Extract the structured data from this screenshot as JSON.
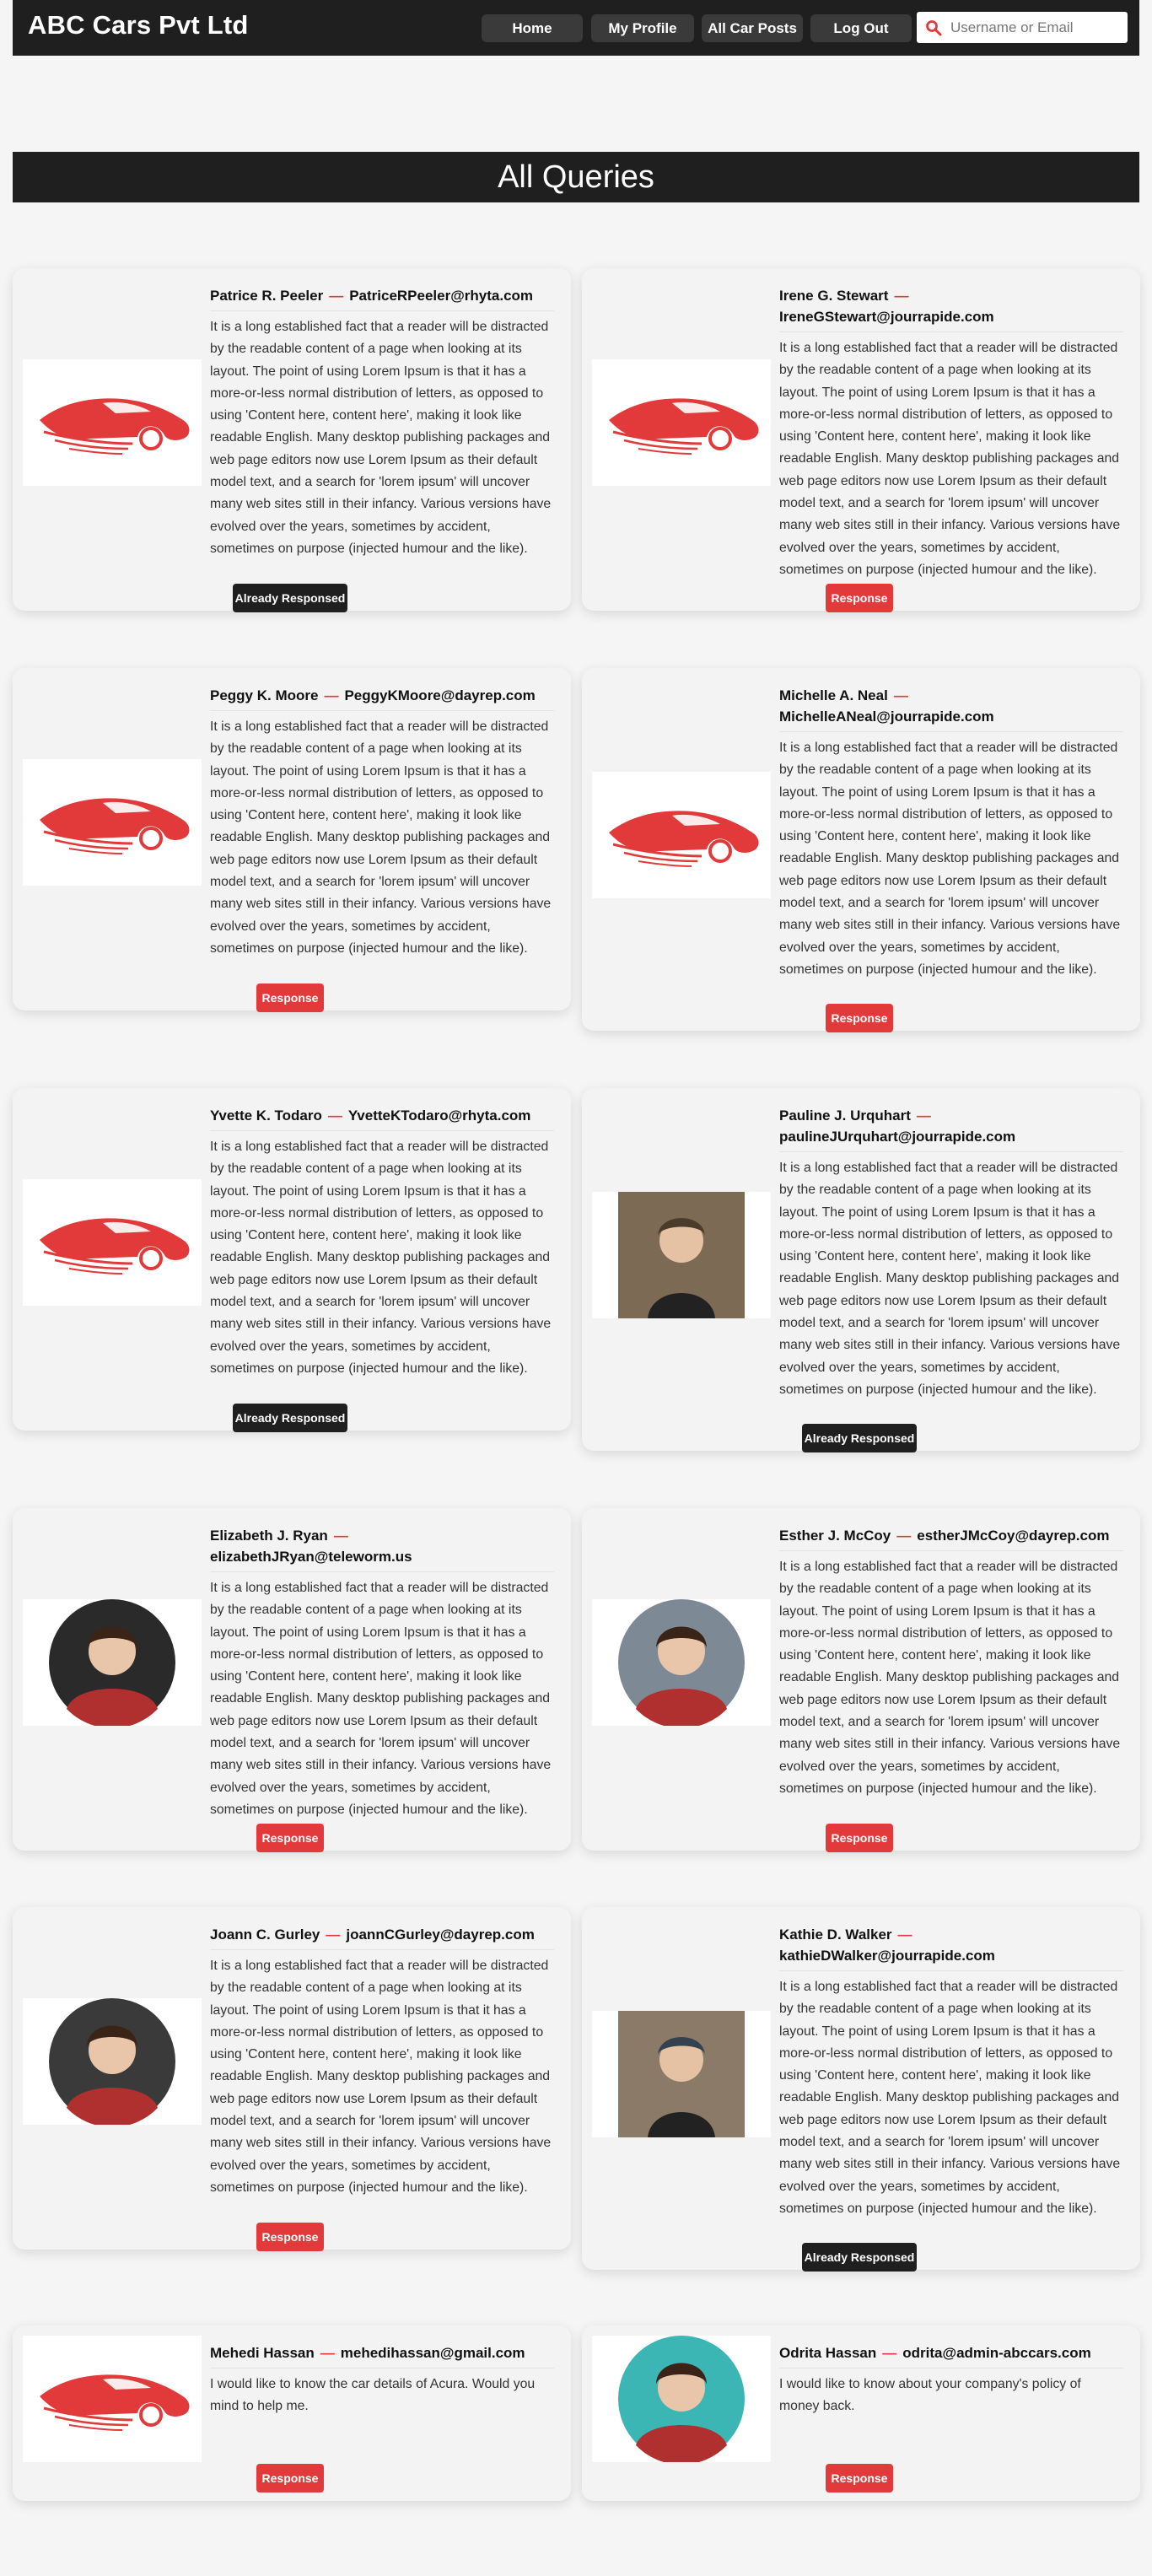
{
  "header": {
    "brand": "ABC Cars Pvt Ltd",
    "nav": [
      "Home",
      "My Profile",
      "All Car Posts",
      "Log Out"
    ],
    "search_placeholder": "Username or Email",
    "search_value": ""
  },
  "page_title": "All Queries",
  "lorem": "It is a long established fact that a reader will be distracted by the readable content of a page when looking at its layout. The point of using Lorem Ipsum is that it has a more-or-less normal distribution of letters, as opposed to using 'Content here, content here', making it look like readable English. Many desktop publishing packages and web page editors now use Lorem Ipsum as their default model text, and a search for 'lorem ipsum' will uncover many web sites still in their infancy. Various versions have evolved over the years, sometimes by accident, sometimes on purpose (injected humour and the like).",
  "queries": [
    {
      "name": "Patrice R. Peeler",
      "email": "PatriceRPeeler@rhyta.com",
      "message": "It is a long established fact that a reader will be distracted by the readable content of a page when looking at its layout. The point of using Lorem Ipsum is that it has a more-or-less normal distribution of letters, as opposed to using 'Content here, content here', making it look like readable English. Many desktop publishing packages and web page editors now use Lorem Ipsum as their default model text, and a search for 'lorem ipsum' will uncover many web sites still in their infancy. Various versions have evolved over the years, sometimes by accident, sometimes on purpose (injected humour and the like).",
      "image": "car-logo",
      "status": "Already Responsed"
    },
    {
      "name": "Irene G. Stewart",
      "email": "IreneGStewart@jourrapide.com",
      "message": "It is a long established fact that a reader will be distracted by the readable content of a page when looking at its layout. The point of using Lorem Ipsum is that it has a more-or-less normal distribution of letters, as opposed to using 'Content here, content here', making it look like readable English. Many desktop publishing packages and web page editors now use Lorem Ipsum as their default model text, and a search for 'lorem ipsum' will uncover many web sites still in their infancy. Various versions have evolved over the years, sometimes by accident, sometimes on purpose (injected humour and the like).",
      "image": "car-logo",
      "status": "Response"
    },
    {
      "name": "Peggy K. Moore",
      "email": "PeggyKMoore@dayrep.com",
      "message": "It is a long established fact that a reader will be distracted by the readable content of a page when looking at its layout. The point of using Lorem Ipsum is that it has a more-or-less normal distribution of letters, as opposed to using 'Content here, content here', making it look like readable English. Many desktop publishing packages and web page editors now use Lorem Ipsum as their default model text, and a search for 'lorem ipsum' will uncover many web sites still in their infancy. Various versions have evolved over the years, sometimes by accident, sometimes on purpose (injected humour and the like).",
      "image": "car-logo",
      "status": "Response"
    },
    {
      "name": "Michelle A. Neal",
      "email": "MichelleANeal@jourrapide.com",
      "message": "It is a long established fact that a reader will be distracted by the readable content of a page when looking at its layout. The point of using Lorem Ipsum is that it has a more-or-less normal distribution of letters, as opposed to using 'Content here, content here', making it look like readable English. Many desktop publishing packages and web page editors now use Lorem Ipsum as their default model text, and a search for 'lorem ipsum' will uncover many web sites still in their infancy. Various versions have evolved over the years, sometimes by accident, sometimes on purpose (injected humour and the like).",
      "image": "car-logo",
      "status": "Response"
    },
    {
      "name": "Yvette K. Todaro",
      "email": "YvetteKTodaro@rhyta.com",
      "message": "It is a long established fact that a reader will be distracted by the readable content of a page when looking at its layout. The point of using Lorem Ipsum is that it has a more-or-less normal distribution of letters, as opposed to using 'Content here, content here', making it look like readable English. Many desktop publishing packages and web page editors now use Lorem Ipsum as their default model text, and a search for 'lorem ipsum' will uncover many web sites still in their infancy. Various versions have evolved over the years, sometimes by accident, sometimes on purpose (injected humour and the like).",
      "image": "car-logo",
      "status": "Already Responsed"
    },
    {
      "name": "Pauline J. Urquhart",
      "email": "paulineJUrquhart@jourrapide.com",
      "message": "It is a long established fact that a reader will be distracted by the readable content of a page when looking at its layout. The point of using Lorem Ipsum is that it has a more-or-less normal distribution of letters, as opposed to using 'Content here, content here', making it look like readable English. Many desktop publishing packages and web page editors now use Lorem Ipsum as their default model text, and a search for 'lorem ipsum' will uncover many web sites still in their infancy. Various versions have evolved over the years, sometimes by accident, sometimes on purpose (injected humour and the like).",
      "image": "user-photo",
      "status": "Already Responsed"
    },
    {
      "name": "Elizabeth J. Ryan",
      "email": "elizabethJRyan@teleworm.us",
      "message": "It is a long established fact that a reader will be distracted by the readable content of a page when looking at its layout. The point of using Lorem Ipsum is that it has a more-or-less normal distribution of letters, as opposed to using 'Content here, content here', making it look like readable English. Many desktop publishing packages and web page editors now use Lorem Ipsum as their default model text, and a search for 'lorem ipsum' will uncover many web sites still in their infancy. Various versions have evolved over the years, sometimes by accident, sometimes on purpose (injected humour and the like).",
      "image": "user-avatar-round",
      "status": "Response"
    },
    {
      "name": "Esther J. McCoy",
      "email": "estherJMcCoy@dayrep.com",
      "message": "It is a long established fact that a reader will be distracted by the readable content of a page when looking at its layout. The point of using Lorem Ipsum is that it has a more-or-less normal distribution of letters, as opposed to using 'Content here, content here', making it look like readable English. Many desktop publishing packages and web page editors now use Lorem Ipsum as their default model text, and a search for 'lorem ipsum' will uncover many web sites still in their infancy. Various versions have evolved over the years, sometimes by accident, sometimes on purpose (injected humour and the like).",
      "image": "user-avatar-round",
      "status": "Response"
    },
    {
      "name": "Joann C. Gurley",
      "email": "joannCGurley@dayrep.com",
      "message": "It is a long established fact that a reader will be distracted by the readable content of a page when looking at its layout. The point of using Lorem Ipsum is that it has a more-or-less normal distribution of letters, as opposed to using 'Content here, content here', making it look like readable English. Many desktop publishing packages and web page editors now use Lorem Ipsum as their default model text, and a search for 'lorem ipsum' will uncover many web sites still in their infancy. Various versions have evolved over the years, sometimes by accident, sometimes on purpose (injected humour and the like).",
      "image": "user-avatar-round",
      "status": "Response"
    },
    {
      "name": "Kathie D. Walker",
      "email": "kathieDWalker@jourrapide.com",
      "message": "It is a long established fact that a reader will be distracted by the readable content of a page when looking at its layout. The point of using Lorem Ipsum is that it has a more-or-less normal distribution of letters, as opposed to using 'Content here, content here', making it look like readable English. Many desktop publishing packages and web page editors now use Lorem Ipsum as their default model text, and a search for 'lorem ipsum' will uncover many web sites still in their infancy. Various versions have evolved over the years, sometimes by accident, sometimes on purpose (injected humour and the like).",
      "image": "user-photo",
      "status": "Already Responsed"
    },
    {
      "name": "Mehedi Hassan",
      "email": "mehedihassan@gmail.com",
      "message": "I would like to know the car details of Acura. Would you mind to help me.",
      "image": "car-logo",
      "status": "Response"
    },
    {
      "name": "Odrita Hassan",
      "email": "odrita@admin-abccars.com",
      "message": "I would like to know about your company's policy of money back.",
      "image": "user-avatar-round",
      "status": "Response"
    }
  ],
  "colors": {
    "accent": "#e23a3a",
    "dark": "#1f1f1f",
    "background": "#f5f5f5"
  }
}
